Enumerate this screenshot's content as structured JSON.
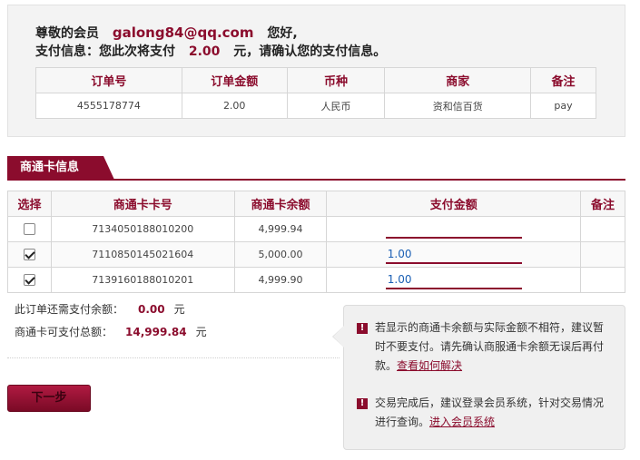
{
  "greeting": {
    "prefix": "尊敬的会员",
    "email": "galong84@qq.com",
    "suffix": "您好,"
  },
  "pay_info": {
    "prefix": "支付信息：您此次将支付",
    "amount": "2.00",
    "suffix": "元，请确认您的支付信息。"
  },
  "order_table": {
    "headers": [
      "订单号",
      "订单金额",
      "币种",
      "商家",
      "备注"
    ],
    "row": [
      "4555178774",
      "2.00",
      "人民币",
      "资和信百货",
      "pay"
    ]
  },
  "section": {
    "title": "商通卡信息"
  },
  "card_table": {
    "headers": [
      "选择",
      "商通卡卡号",
      "商通卡余额",
      "支付金额",
      "备注"
    ],
    "rows": [
      {
        "checked": false,
        "card_no": "7134050188010200",
        "balance": "4,999.94",
        "pay": "",
        "note": ""
      },
      {
        "checked": true,
        "card_no": "7110850145021604",
        "balance": "5,000.00",
        "pay": "1.00",
        "note": ""
      },
      {
        "checked": true,
        "card_no": "7139160188010201",
        "balance": "4,999.90",
        "pay": "1.00",
        "note": ""
      }
    ]
  },
  "remaining": {
    "label": "此订单还需支付余额：",
    "value": "0.00",
    "unit": "元"
  },
  "total": {
    "label": "商通卡可支付总额：",
    "value": "14,999.84",
    "unit": "元"
  },
  "next_button": {
    "label": "下一步"
  },
  "tips": {
    "icon": "warning-icon",
    "tip1_text": "若显示的商通卡余额与实际金额不相符，建议暂时不要支付。请先确认商服通卡余额无误后再付款。",
    "tip1_link": "查看如何解决",
    "tip2_text": "交易完成后，建议登录会员系统，针对交易情况进行查询。",
    "tip2_link": "进入会员系统"
  },
  "colors": {
    "accent": "#8b0c2d",
    "link_blue": "#1a5fb4",
    "panel_bg": "#f3f3f3"
  }
}
